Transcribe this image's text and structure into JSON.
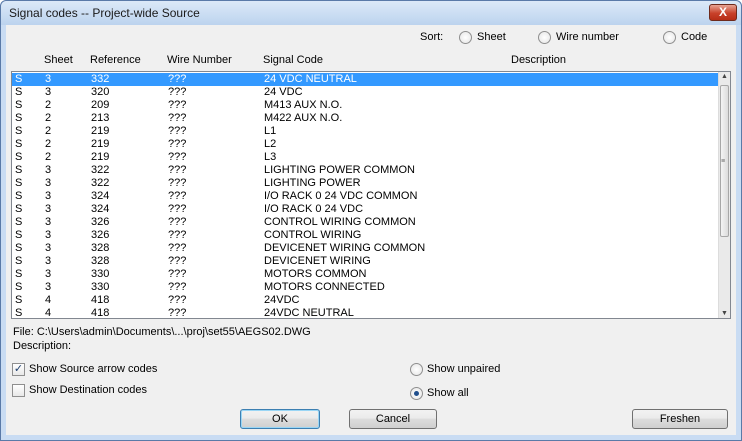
{
  "window": {
    "title": "Signal codes -- Project-wide Source",
    "close_glyph": "X"
  },
  "sort": {
    "label": "Sort:",
    "options": [
      "Sheet",
      "Wire number",
      "Code"
    ],
    "selected": ""
  },
  "columns": [
    "Sheet",
    "Reference",
    "Wire Number",
    "Signal Code",
    "Description"
  ],
  "rows": [
    [
      "S",
      "3",
      "332",
      "???",
      "24 VDC NEUTRAL"
    ],
    [
      "S",
      "3",
      "320",
      "???",
      "24 VDC"
    ],
    [
      "S",
      "2",
      "209",
      "???",
      "M413 AUX N.O."
    ],
    [
      "S",
      "2",
      "213",
      "???",
      "M422 AUX N.O."
    ],
    [
      "S",
      "2",
      "219",
      "???",
      "L1"
    ],
    [
      "S",
      "2",
      "219",
      "???",
      "L2"
    ],
    [
      "S",
      "2",
      "219",
      "???",
      "L3"
    ],
    [
      "S",
      "3",
      "322",
      "???",
      "LIGHTING POWER COMMON"
    ],
    [
      "S",
      "3",
      "322",
      "???",
      "LIGHTING POWER"
    ],
    [
      "S",
      "3",
      "324",
      "???",
      "I/O RACK 0 24 VDC COMMON"
    ],
    [
      "S",
      "3",
      "324",
      "???",
      "I/O RACK 0 24 VDC"
    ],
    [
      "S",
      "3",
      "326",
      "???",
      "CONTROL WIRING COMMON"
    ],
    [
      "S",
      "3",
      "326",
      "???",
      "CONTROL WIRING"
    ],
    [
      "S",
      "3",
      "328",
      "???",
      "DEVICENET WIRING COMMON"
    ],
    [
      "S",
      "3",
      "328",
      "???",
      "DEVICENET WIRING"
    ],
    [
      "S",
      "3",
      "330",
      "???",
      "MOTORS COMMON"
    ],
    [
      "S",
      "3",
      "330",
      "???",
      "MOTORS CONNECTED"
    ],
    [
      "S",
      "4",
      "418",
      "???",
      "24VDC"
    ],
    [
      "S",
      "4",
      "418",
      "???",
      "24VDC NEUTRAL"
    ]
  ],
  "selected_row": 0,
  "file": {
    "file_text": "File: C:\\Users\\admin\\Documents\\...\\proj\\set55\\AEGS02.DWG",
    "description_label": "Description:"
  },
  "options": {
    "show_source": "Show Source arrow codes",
    "show_source_checked": true,
    "show_destination": "Show Destination codes",
    "show_destination_checked": false,
    "show_unpaired": "Show unpaired",
    "show_all": "Show all",
    "filter_selected": "Show all"
  },
  "buttons": {
    "ok": "OK",
    "cancel": "Cancel",
    "freshen": "Freshen"
  },
  "scrollbar": {
    "up": "▲",
    "down": "▼",
    "grip": "≡"
  }
}
